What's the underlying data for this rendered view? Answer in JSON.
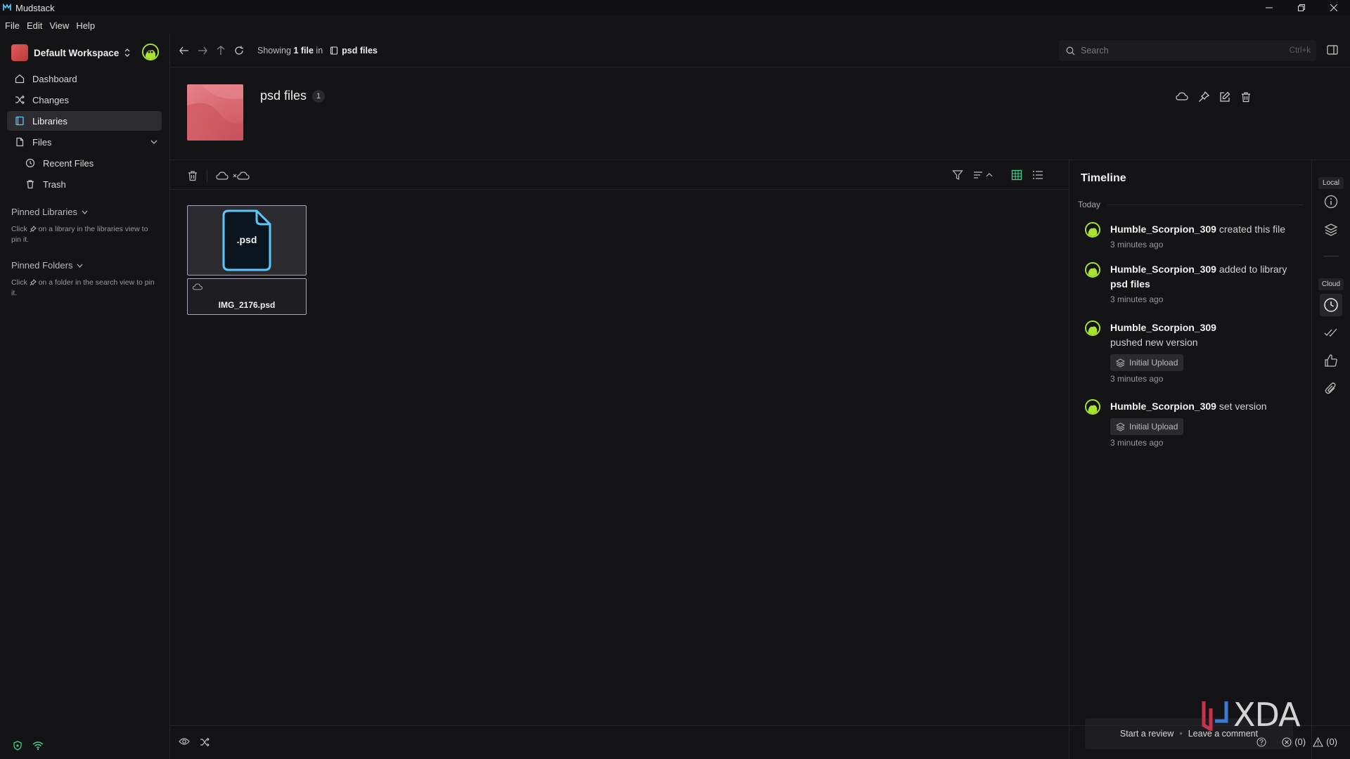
{
  "app": {
    "title": "Mudstack"
  },
  "menu": [
    "File",
    "Edit",
    "View",
    "Help"
  ],
  "sidebar": {
    "workspace": "Default Workspace",
    "items": [
      {
        "label": "Dashboard",
        "icon": "home-icon",
        "active": false
      },
      {
        "label": "Changes",
        "icon": "shuffle-icon",
        "active": false
      },
      {
        "label": "Libraries",
        "icon": "book-icon",
        "active": true
      },
      {
        "label": "Files",
        "icon": "file-icon",
        "active": false
      }
    ],
    "subitems": [
      {
        "label": "Recent Files",
        "icon": "history-icon"
      },
      {
        "label": "Trash",
        "icon": "trash-icon"
      }
    ],
    "pinned_libraries": {
      "title": "Pinned Libraries",
      "hint_prefix": "Click",
      "hint_suffix": "on a library in the libraries view to pin it."
    },
    "pinned_folders": {
      "title": "Pinned Folders",
      "hint_prefix": "Click",
      "hint_suffix": "on a folder in the search view to pin it."
    }
  },
  "topbar": {
    "showing_prefix": "Showing",
    "showing_count": "1 file",
    "showing_suffix": "in",
    "location": "psd files",
    "search_placeholder": "Search",
    "search_shortcut": "Ctrl+k"
  },
  "library": {
    "name": "psd files",
    "count": "1",
    "thumb_color": "#d8646c"
  },
  "files": [
    {
      "ext": ".psd",
      "name": "IMG_2176.psd"
    }
  ],
  "timeline": {
    "title": "Timeline",
    "day": "Today",
    "entries": [
      {
        "user": "Humble_Scorpion_309",
        "action": "created this file",
        "time": "3 minutes ago"
      },
      {
        "user": "Humble_Scorpion_309",
        "action": "added to library",
        "target": "psd files",
        "time": "3 minutes ago"
      },
      {
        "user": "Humble_Scorpion_309",
        "action": "pushed new version",
        "badge": "Initial Upload",
        "time": "3 minutes ago"
      },
      {
        "user": "Humble_Scorpion_309",
        "action": "set version",
        "badge": "Initial Upload",
        "time": "3 minutes ago"
      }
    ],
    "review_label": "Start a review",
    "comment_label": "Leave a comment"
  },
  "rail": {
    "local_label": "Local",
    "cloud_label": "Cloud"
  },
  "status": {
    "errors": "(0)",
    "warnings": "(0)"
  },
  "watermark": "XDA",
  "colors": {
    "accent": "#5ac8fa",
    "avatar_ring": "#a9e332",
    "status_green": "#3ecf8e"
  }
}
